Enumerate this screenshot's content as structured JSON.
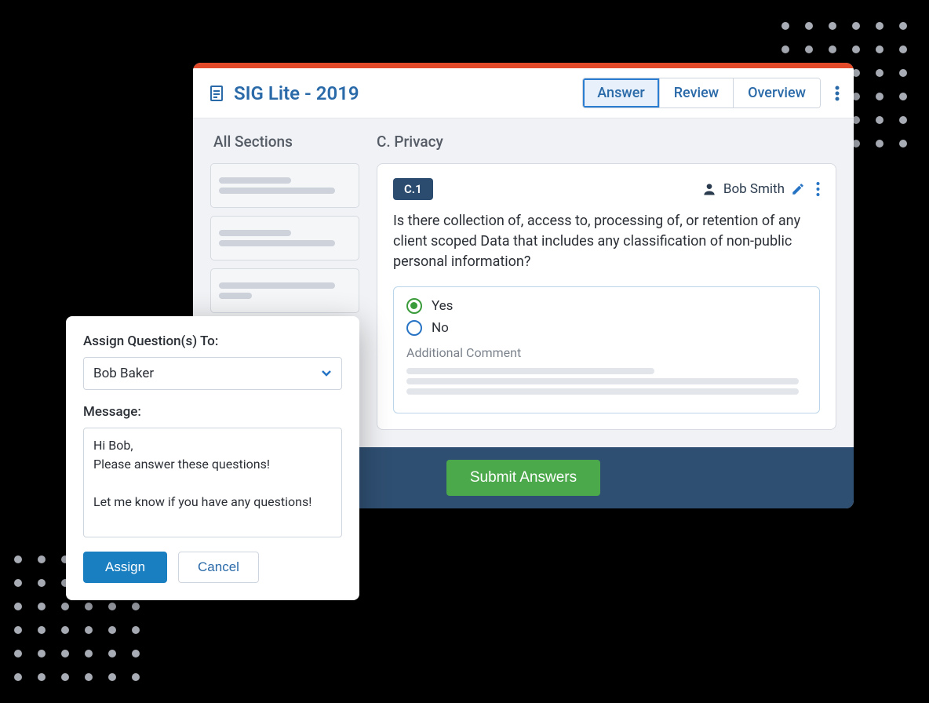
{
  "header": {
    "title": "SIG Lite - 2019",
    "tabs": [
      {
        "label": "Answer",
        "active": true
      },
      {
        "label": "Review",
        "active": false
      },
      {
        "label": "Overview",
        "active": false
      }
    ]
  },
  "sidebar": {
    "title": "All Sections"
  },
  "main": {
    "section_title": "C. Privacy",
    "question": {
      "id": "C.1",
      "assignee": "Bob Smith",
      "text": "Is there collection of, access to, processing of, or retention of any client scoped Data that includes any classification of non-public personal information?",
      "options": [
        {
          "label": "Yes",
          "selected": true
        },
        {
          "label": "No",
          "selected": false
        }
      ],
      "comment_label": "Additional Comment"
    }
  },
  "footer": {
    "submit_label": "Submit Answers"
  },
  "modal": {
    "assign_label": "Assign Question(s) To:",
    "assignee": "Bob Baker",
    "message_label": "Message:",
    "message_value": "Hi Bob,\nPlease answer these questions!\n\nLet me know if you have any questions!",
    "assign_btn": "Assign",
    "cancel_btn": "Cancel"
  }
}
